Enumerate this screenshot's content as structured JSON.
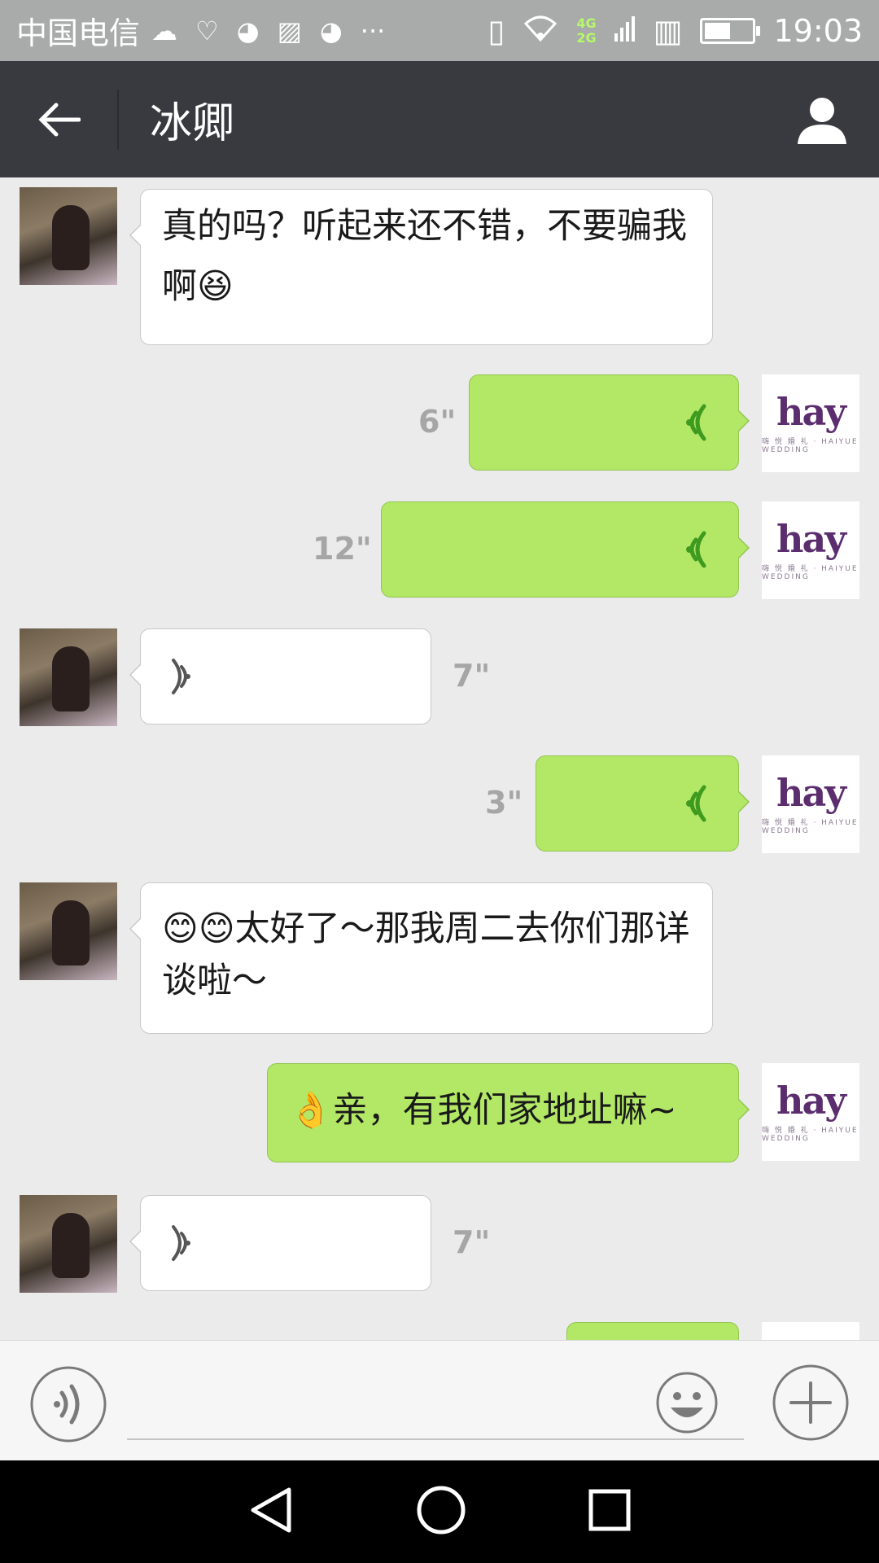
{
  "status_bar": {
    "carrier": "中国电信",
    "network_top": "4G",
    "network_bottom": "2G",
    "battery_level": 0.5,
    "time": "19:03",
    "notification_icons": [
      "cloud-icon",
      "health-icon",
      "qq-icon",
      "gallery-icon",
      "qq-icon",
      "more-icon"
    ]
  },
  "header": {
    "title": "冰卿",
    "back_icon": "arrow-left-icon",
    "profile_icon": "person-icon"
  },
  "messages": [
    {
      "side": "in",
      "type": "text",
      "text": "真的吗？听起来还不错，不要骗我啊😆"
    },
    {
      "side": "out",
      "type": "voice",
      "duration": "6\""
    },
    {
      "side": "out",
      "type": "voice",
      "duration": "12\""
    },
    {
      "side": "in",
      "type": "voice",
      "duration": "7\""
    },
    {
      "side": "out",
      "type": "voice",
      "duration": "3\""
    },
    {
      "side": "in",
      "type": "text",
      "text": "😊😊太好了～那我周二去你们那详谈啦～"
    },
    {
      "side": "out",
      "type": "text",
      "text": "👌亲，有我们家地址嘛~"
    },
    {
      "side": "in",
      "type": "voice",
      "duration": "7\""
    }
  ],
  "logo_avatar": {
    "mark": "hay",
    "sub": "嗨 悦 婚 礼 · HAIYUE WEDDING"
  },
  "input_bar": {
    "voice_icon": "voice-icon",
    "emoji_icon": "emoji-icon",
    "plus_icon": "plus-icon"
  },
  "colors": {
    "out_bubble": "#b2e865",
    "in_bubble": "#ffffff",
    "title_bar": "#393a3f",
    "chat_bg": "#ebebeb"
  }
}
